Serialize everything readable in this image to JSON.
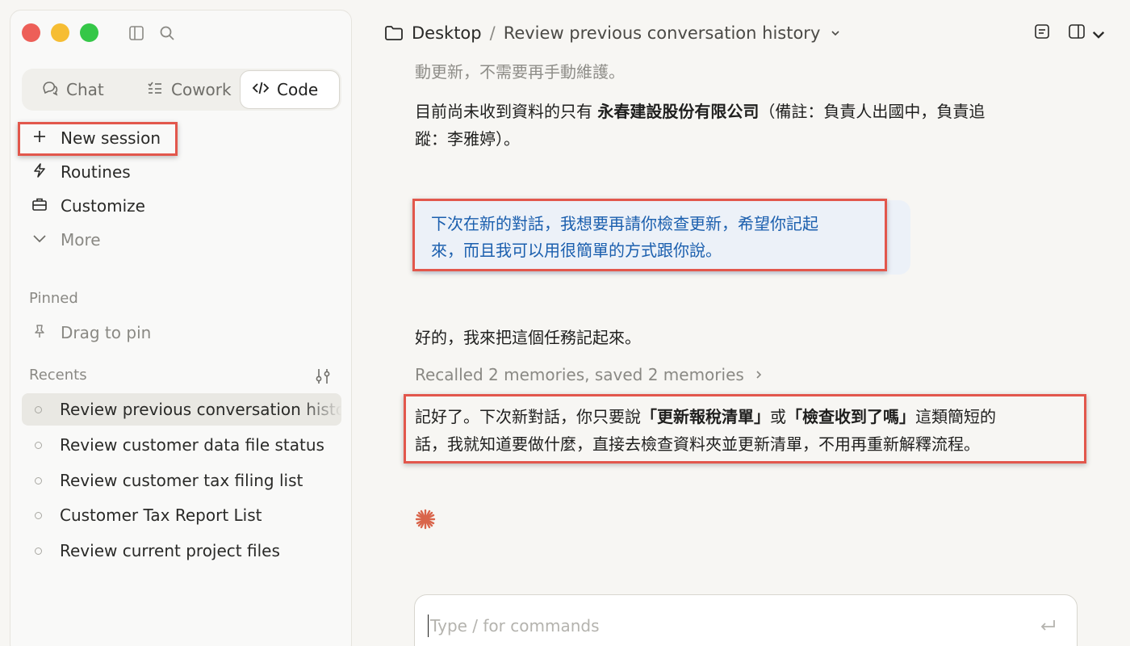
{
  "sidebar": {
    "tabs": [
      {
        "label": "Chat",
        "icon": "chat-bubbles-icon"
      },
      {
        "label": "Cowork",
        "icon": "checklist-icon"
      },
      {
        "label": "Code",
        "icon": "code-icon"
      }
    ],
    "nav": [
      {
        "label": "New session",
        "icon": "plus-icon"
      },
      {
        "label": "Routines",
        "icon": "bolt-icon"
      },
      {
        "label": "Customize",
        "icon": "briefcase-icon"
      },
      {
        "label": "More",
        "icon": "chevron-down-icon"
      }
    ],
    "pinned_label": "Pinned",
    "drag_to_pin": "Drag to pin",
    "recents_label": "Recents",
    "recents": [
      "Review previous conversation history",
      "Review customer data file status",
      "Review customer tax filing list",
      "Customer Tax Report List",
      "Review current project files"
    ]
  },
  "header": {
    "folder": "Desktop",
    "separator": "/",
    "title": "Review previous conversation history"
  },
  "conversation": {
    "partial_line": "動更新，不需要再手動維護。",
    "status_line": {
      "prefix": "目前尚未收到資料的只有 ",
      "company": "永春建設股份有限公司",
      "suffix_1": "（備註：負責人出國中，負責追",
      "suffix_2": "蹤：李雅婷）。"
    },
    "user_message": {
      "line1": "下次在新的對話，我想要再請你檢查更新，希望你記起",
      "line2": "來，而且我可以用很簡單的方式跟你說。"
    },
    "assistant_intro": "好的，我來把這個任務記起來。",
    "recalled": "Recalled 2 memories, saved 2 memories",
    "assistant_reply": {
      "part1": "記好了。下次新對話，你只要說",
      "cmd1": "「更新報稅清單」",
      "part2": "或",
      "cmd2": "「檢查收到了嗎」",
      "part3": "這類簡短的",
      "line2": "話，我就知道要做什麼，直接去檢查資料夾並更新清單，不用再重新解釋流程。"
    }
  },
  "composer": {
    "placeholder": "Type / for commands"
  },
  "colors": {
    "accent_user_text": "#1b5fae",
    "user_bubble": "#ecf1f8",
    "annotation_red": "#e2574c",
    "claude_orange": "#d9654b"
  }
}
